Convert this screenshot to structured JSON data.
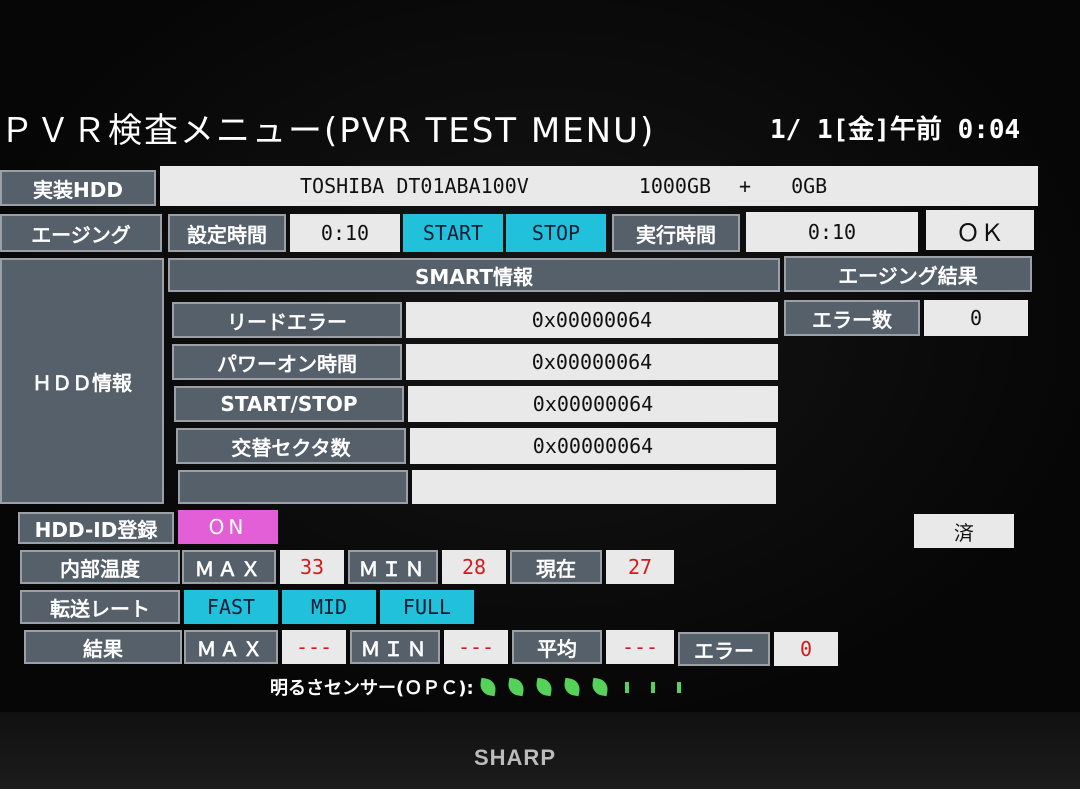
{
  "header": {
    "title": "ＰＶＲ検査メニュー(PVR TEST MENU)",
    "clock": "1/ 1[金]午前 0:04"
  },
  "hdd": {
    "label": "実装HDD",
    "model": "TOSHIBA DT01ABA100V",
    "capacity": "1000GB",
    "plus": "+",
    "extra": "0GB"
  },
  "aging": {
    "label": "エージング",
    "set_time_label": "設定時間",
    "set_time": "0:10",
    "start": "START",
    "stop": "STOP",
    "run_time_label": "実行時間",
    "run_time": "0:10",
    "ok": "ＯＫ"
  },
  "smart": {
    "section_label": "ＨＤＤ情報",
    "header": "SMART情報",
    "rows": [
      {
        "label": "リードエラー",
        "value": "0x00000064"
      },
      {
        "label": "パワーオン時間",
        "value": "0x00000064"
      },
      {
        "label": "START/STOP",
        "value": "0x00000064"
      },
      {
        "label": "交替セクタ数",
        "value": "0x00000064"
      },
      {
        "label": "",
        "value": ""
      }
    ]
  },
  "aging_result": {
    "header": "エージング結果",
    "error_label": "エラー数",
    "error_value": "0"
  },
  "hdd_id": {
    "label": "HDD-ID登録",
    "value": "ON",
    "done": "済"
  },
  "temperature": {
    "label": "内部温度",
    "max_label": "ＭＡＸ",
    "max": "33",
    "min_label": "ＭＩＮ",
    "min": "28",
    "current_label": "現在",
    "current": "27"
  },
  "transfer": {
    "label": "転送レート",
    "options": [
      "FAST",
      "MID",
      "FULL"
    ]
  },
  "result": {
    "label": "結果",
    "max_label": "ＭＡＸ",
    "max": "---",
    "min_label": "ＭＩＮ",
    "min": "---",
    "avg_label": "平均",
    "avg": "---",
    "error_label": "エラー",
    "error": "0"
  },
  "opc": {
    "label": "明るさセンサー(ＯＰＣ):",
    "level": 5,
    "max": 8
  },
  "bezel": {
    "brand": "SHARP"
  },
  "colors": {
    "header_gray": "#56606a",
    "light_cell": "#e9e9e9",
    "cyan": "#22c1db",
    "pink": "#e35fd8",
    "red_value": "#d21b1b",
    "opc_green": "#56d15a"
  }
}
